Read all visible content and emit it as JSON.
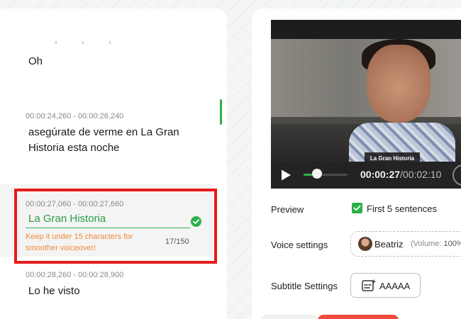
{
  "subtitles": {
    "items": [
      {
        "time": "",
        "text": "Oh"
      },
      {
        "time": "00:00:24,260 - 00:00:26,240",
        "text_line1": "asegúrate de verme en La Gran",
        "text_line2": "Historia esta noche"
      },
      {
        "time": "00:00:27,060 - 00:00:27,660",
        "text": "La Gran Historia",
        "warning_line1": "Keep it under 15 characters for",
        "warning_line2": "smoother voiceover!",
        "counter": "17/150"
      },
      {
        "time": "00:00:28,260 - 00:00:28,900",
        "text": "Lo he visto"
      }
    ]
  },
  "player": {
    "caption": "La Gran Historia",
    "current_time": "00:00:27",
    "duration": "/00:02:10",
    "progress_fraction": 0.2
  },
  "settings": {
    "preview_label": "Preview",
    "preview_checkbox_label": "First 5 sentences",
    "voice_label": "Voice settings",
    "voice_name": "Beatriz",
    "voice_volume_prefix": "(Volume: ",
    "voice_volume_value": "100%)",
    "subtitle_label": "Subtitle Settings",
    "subtitle_button_label": "AAAAA"
  },
  "colors": {
    "accent": "#2bb24c",
    "warning": "#f08a3c",
    "highlight": "#e51b1b"
  },
  "icons": {
    "check": "check-circle-icon",
    "play": "play-icon",
    "subtitle": "subtitle-style-icon"
  }
}
